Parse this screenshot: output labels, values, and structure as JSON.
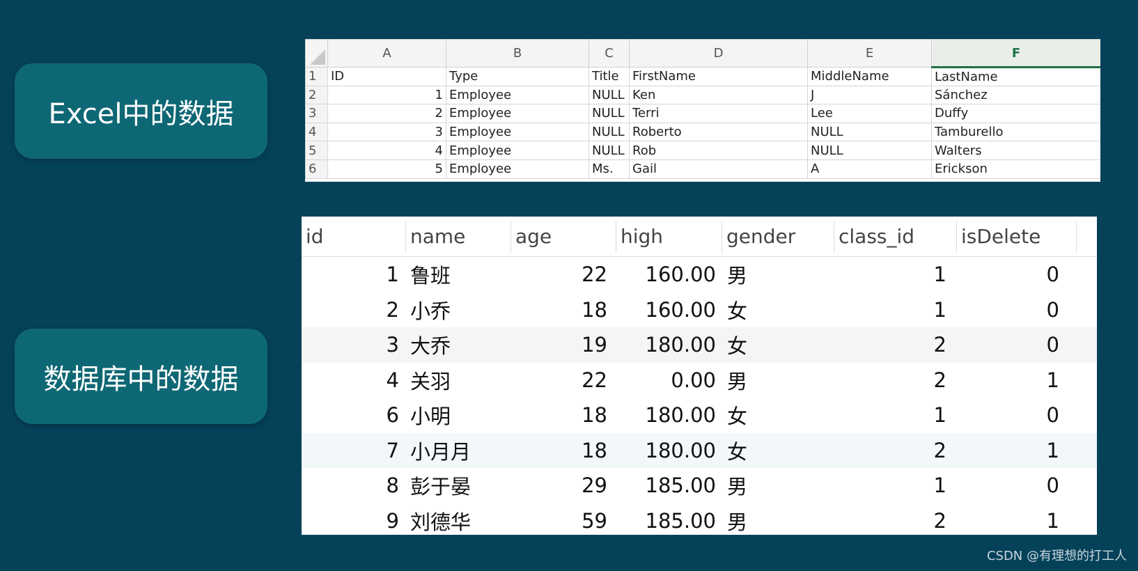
{
  "labels": {
    "excel": "Excel中的数据",
    "database": "数据库中的数据"
  },
  "excel": {
    "columns": [
      "A",
      "B",
      "C",
      "D",
      "E",
      "F"
    ],
    "rows": [
      {
        "n": "1",
        "cells": [
          "ID",
          "Type",
          "Title",
          "FirstName",
          "MiddleName",
          "LastName"
        ]
      },
      {
        "n": "2",
        "cells": [
          "1",
          "Employee",
          "NULL",
          "Ken",
          "J",
          "Sánchez"
        ]
      },
      {
        "n": "3",
        "cells": [
          "2",
          "Employee",
          "NULL",
          "Terri",
          "Lee",
          "Duffy"
        ]
      },
      {
        "n": "4",
        "cells": [
          "3",
          "Employee",
          "NULL",
          "Roberto",
          "NULL",
          "Tamburello"
        ]
      },
      {
        "n": "5",
        "cells": [
          "4",
          "Employee",
          "NULL",
          "Rob",
          "NULL",
          "Walters"
        ]
      },
      {
        "n": "6",
        "cells": [
          "5",
          "Employee",
          "Ms.",
          "Gail",
          "A",
          "Erickson"
        ]
      }
    ]
  },
  "database": {
    "headers": [
      "id",
      "name",
      "age",
      "high",
      "gender",
      "class_id",
      "isDelete"
    ],
    "rows": [
      [
        "1",
        "鲁班",
        "22",
        "160.00",
        "男",
        "1",
        "0"
      ],
      [
        "2",
        "小乔",
        "18",
        "160.00",
        "女",
        "1",
        "0"
      ],
      [
        "3",
        "大乔",
        "19",
        "180.00",
        "女",
        "2",
        "0"
      ],
      [
        "4",
        "关羽",
        "22",
        "0.00",
        "男",
        "2",
        "1"
      ],
      [
        "6",
        "小明",
        "18",
        "180.00",
        "女",
        "1",
        "0"
      ],
      [
        "7",
        "小月月",
        "18",
        "180.00",
        "女",
        "2",
        "1"
      ],
      [
        "8",
        "彭于晏",
        "29",
        "185.00",
        "男",
        "1",
        "0"
      ],
      [
        "9",
        "刘德华",
        "59",
        "185.00",
        "男",
        "2",
        "1"
      ]
    ]
  },
  "watermark": "CSDN @有理想的打工人"
}
